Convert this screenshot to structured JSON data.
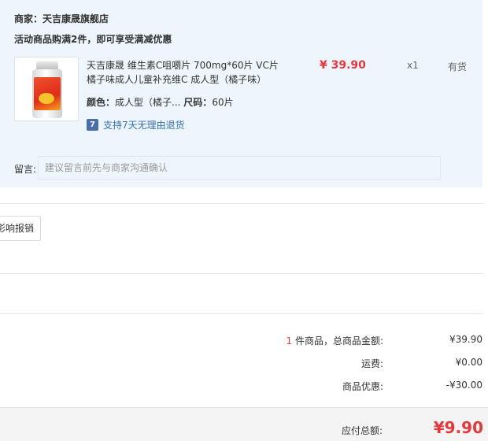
{
  "order": {
    "merchant": "商家：天吉康晟旗舰店",
    "promo": "活动商品购满2件，即可享受满减优惠"
  },
  "product": {
    "title": "天吉康晟 维生素C咀嚼片 700mg*60片 VC片橘子味成人儿童补充维C 成人型（橘子味）",
    "spec_color_key": "颜色：",
    "spec_color_value": "成人型（橘子...",
    "spec_size_key": "尺码：",
    "spec_size_value": "60片",
    "return_icon": "7",
    "return_policy": "支持7天无理由退货",
    "price": "¥ 39.90",
    "quantity": "x1",
    "stock": "有货",
    "image_icon": "vitamin-c-bottle"
  },
  "note": {
    "label": "留言:",
    "placeholder": "建议留言前先与商家沟通确认"
  },
  "invoice": {
    "button_label": "影响报销"
  },
  "summary": {
    "item_count": "1",
    "item_label": " 件商品，总商品金额:",
    "item_total": "¥39.90",
    "shipping_label": "运费:",
    "shipping_value": "¥0.00",
    "discount_label": "商品优惠:",
    "discount_value": "-¥30.00"
  },
  "payment": {
    "total_label": "应付总额:",
    "total_value": "¥9.90"
  },
  "colors": {
    "accent_red": "#e4393c",
    "panel_blue": "#edf6fd",
    "link_blue": "#3a6fb3"
  }
}
